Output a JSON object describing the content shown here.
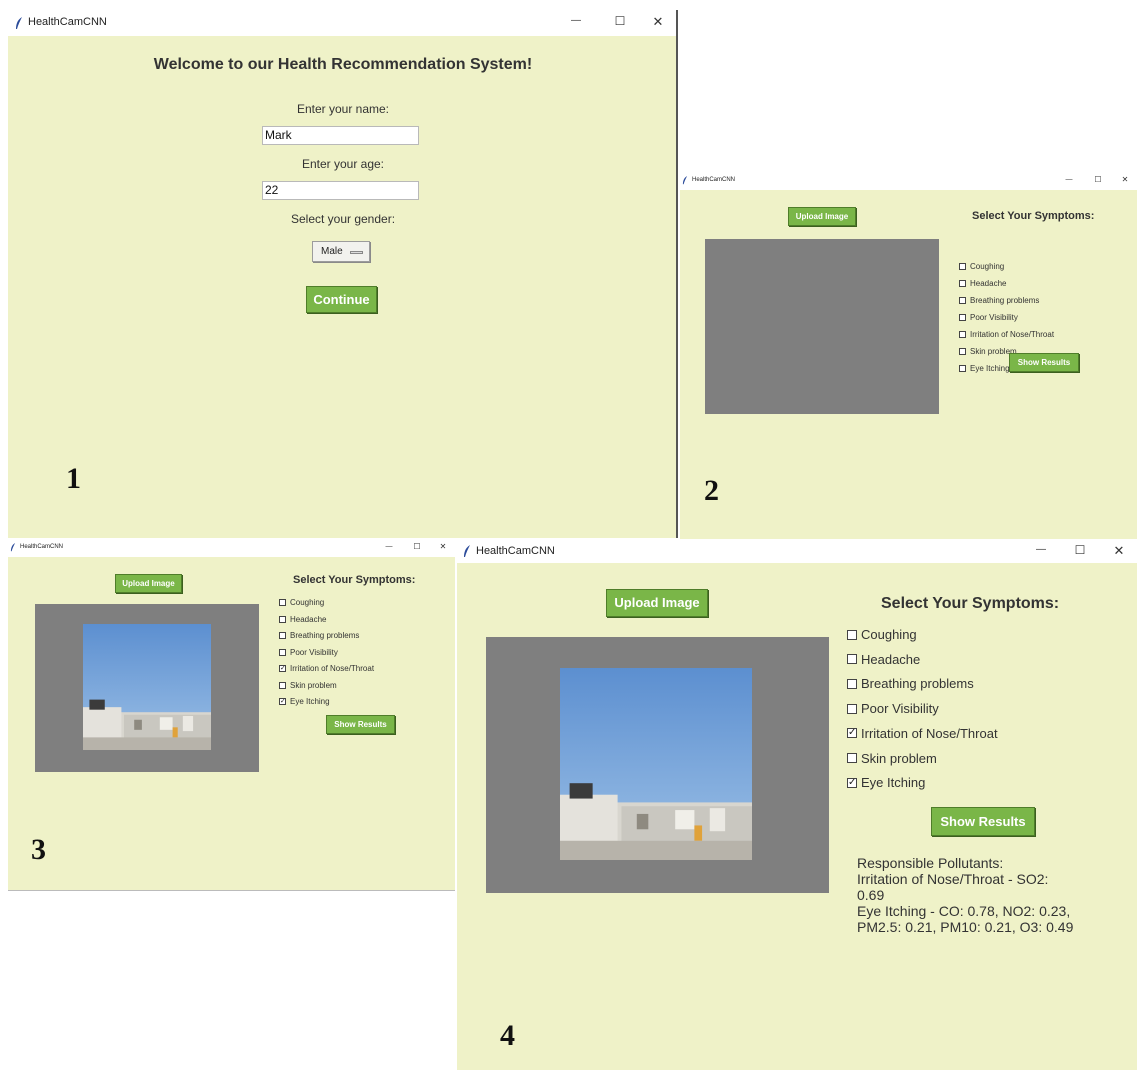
{
  "app": {
    "title": "HealthCamCNN"
  },
  "panel_labels": [
    "1",
    "2",
    "3",
    "4"
  ],
  "window_controls": {
    "minimize": "—",
    "maximize": "☐",
    "close": "✕"
  },
  "welcome": {
    "heading": "Welcome to our Health Recommendation System!",
    "name_label": "Enter your name:",
    "name_value": "Mark",
    "age_label": "Enter your age:",
    "age_value": "22",
    "gender_label": "Select your gender:",
    "gender_value": "Male",
    "continue_label": "Continue"
  },
  "symptoms_screen": {
    "upload_label": "Upload Image",
    "heading": "Select Your Symptoms:",
    "show_results_label": "Show Results",
    "symptoms": [
      {
        "label": "Coughing"
      },
      {
        "label": "Headache"
      },
      {
        "label": "Breathing problems"
      },
      {
        "label": "Poor Visibility"
      },
      {
        "label": "Irritation of Nose/Throat"
      },
      {
        "label": "Skin problem"
      },
      {
        "label": "Eye Itching"
      }
    ],
    "checked_after_upload": [
      "Irritation of Nose/Throat",
      "Eye Itching"
    ]
  },
  "results": {
    "lines": [
      "Responsible Pollutants:",
      "Irritation of Nose/Throat - SO2:",
      "0.69",
      "Eye Itching - CO: 0.78, NO2: 0.23,",
      "PM2.5: 0.21, PM10: 0.21, O3: 0.49"
    ]
  },
  "colors": {
    "window_bg": "#eff2c8",
    "button_green": "#7ab648",
    "canvas_gray": "#7f7f7f",
    "sky_blue": "#6f9fd8"
  }
}
